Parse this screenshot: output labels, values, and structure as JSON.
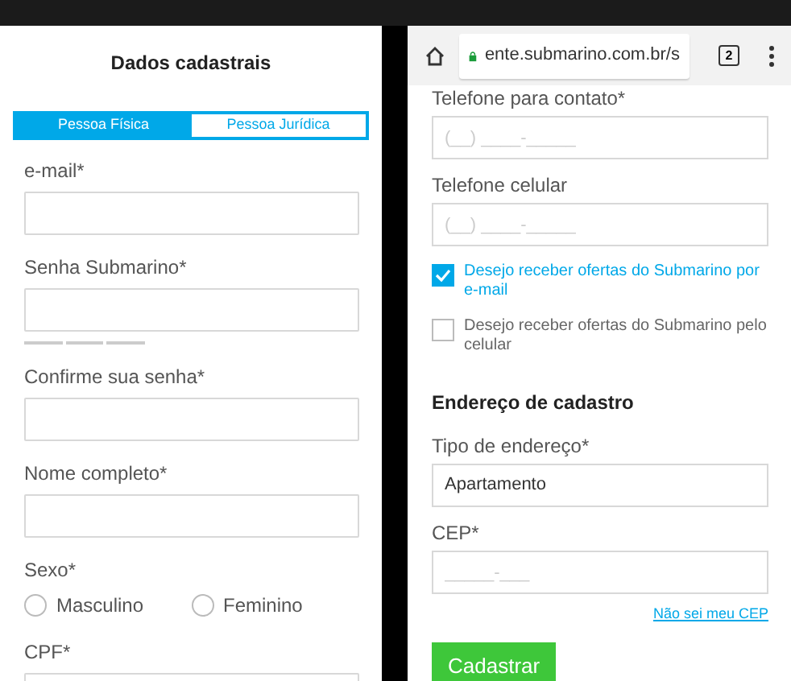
{
  "left_screen": {
    "title": "Dados cadastrais",
    "tabs": [
      {
        "label": "Pessoa Física",
        "selected": true
      },
      {
        "label": "Pessoa Jurídica",
        "selected": false
      }
    ],
    "fields": [
      {
        "kind": "text",
        "label": "e-mail*"
      },
      {
        "kind": "password",
        "label": "Senha Submarino*"
      },
      {
        "kind": "text",
        "label": "Confirme sua senha*"
      },
      {
        "kind": "text",
        "label": "Nome completo*"
      },
      {
        "kind": "radio",
        "label": "Sexo*",
        "options": [
          {
            "label": "Masculino",
            "selected": false
          },
          {
            "label": "Feminino",
            "selected": false
          }
        ]
      },
      {
        "kind": "text",
        "label": "CPF*"
      }
    ]
  },
  "right_screen": {
    "browser_bar": {
      "url": "ente.submarino.com.br/s",
      "tab_count": "2"
    },
    "items": [
      {
        "kind": "field",
        "label": "Telefone para contato*",
        "placeholder": "(__) ____-_____"
      },
      {
        "kind": "field",
        "label": "Telefone celular",
        "placeholder": "(__) ____-_____"
      },
      {
        "kind": "checkbox",
        "label": "Desejo receber ofertas do Submarino por e-mail",
        "checked": true
      },
      {
        "kind": "checkbox",
        "label": "Desejo receber ofertas do Submarino pelo celular",
        "checked": false
      },
      {
        "kind": "heading",
        "label": "Endereço de cadastro"
      },
      {
        "kind": "field",
        "label": "Tipo de endereço*",
        "value": "Apartamento"
      },
      {
        "kind": "field",
        "label": "CEP*",
        "placeholder": "_____-___"
      },
      {
        "kind": "link",
        "label": "Não sei meu CEP"
      },
      {
        "kind": "button",
        "label": "Cadastrar"
      }
    ]
  }
}
